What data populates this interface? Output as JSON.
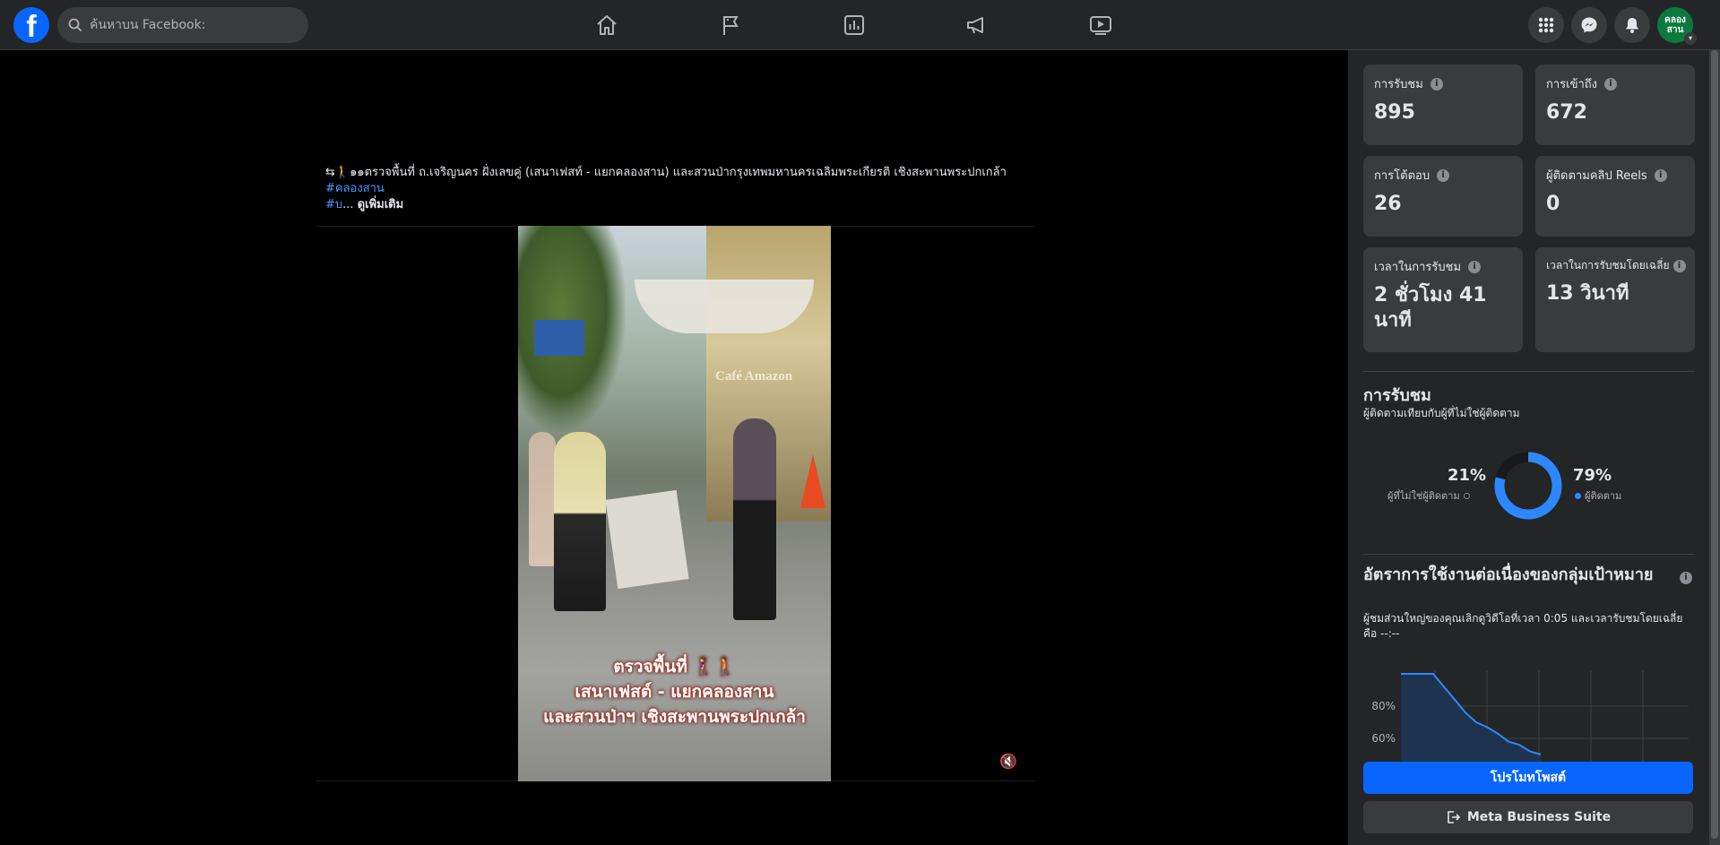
{
  "topbar": {
    "logo": "f",
    "search_placeholder": "ค้นหาบน Facebook:",
    "nav": [
      "home-icon",
      "flag-icon",
      "insights-icon",
      "megaphone-icon",
      "video-icon"
    ],
    "avatar_text": "คลอง สาน"
  },
  "post": {
    "caption": "⇆🚶๑๑ตรวจพื้นที่ ถ.เจริญนคร ฝั่งเลขคู่ (เสนาเฟสท์ - แยกคลองสาน) และสวนป่ากรุงเทพมหานครเฉลิมพระเกียรติ เชิงสะพานพระปกเกล้า",
    "hashtag1": "#คลองสาน",
    "hashtag2": "#บ",
    "ellipsis": "...",
    "see_more": "ดูเพิ่มเติม",
    "video_sign": "Café Amazon",
    "video_caption_1": "ตรวจพื้นที่ 🚶‍♀️🚶",
    "video_caption_2": "เสนาเฟสต์ - แยกคลองสาน",
    "video_caption_3": "และสวนป่าฯ เชิงสะพานพระปกเกล้า",
    "mute_icon": "🔇"
  },
  "stats": {
    "views_label": "การรับชม",
    "views": "895",
    "reach_label": "การเข้าถึง",
    "reach": "672",
    "interactions_label": "การโต้ตอบ",
    "interactions": "26",
    "reels_followers_label": "ผู้ติดตามคลิป Reels",
    "reels_followers": "0",
    "watch_time_label": "เวลาในการรับชม",
    "watch_time": "2 ชั่วโมง 41 นาที",
    "avg_watch_label": "เวลาในการรับชมโดยเฉลี่ย",
    "avg_watch": "13 วินาที"
  },
  "views_section": {
    "title": "การรับชม",
    "subtitle": "ผู้ติดตามเทียบกับผู้ที่ไม่ใช่ผู้ติดตาม",
    "non_followers_pct": "21%",
    "non_followers_label": "ผู้ที่ไม่ใช่ผู้ติดตาม",
    "followers_pct": "79%",
    "followers_label": "ผู้ติดตาม",
    "non_followers_value": 21,
    "followers_value": 79,
    "followers_color": "#2d88ff",
    "non_followers_color": "#18191a"
  },
  "retention": {
    "title": "อัตราการใช้งานต่อเนื่องของกลุ่มเป้าหมาย",
    "subtitle": "ผู้ชมส่วนใหญ่ของคุณเลิกดูวิดีโอที่เวลา 0:05 และเวลารับชมโดยเฉลี่ยคือ --:--",
    "y_ticks": [
      "80%",
      "60%"
    ]
  },
  "chart_data": {
    "type": "area",
    "y_ticks": [
      80,
      60
    ],
    "values": [
      100,
      100,
      100,
      100,
      92,
      84,
      76,
      70,
      67,
      63,
      58,
      56,
      52,
      50
    ]
  },
  "buttons": {
    "promote": "โปรโมทโพสต์",
    "business_suite": "Meta Business Suite"
  },
  "colors": {
    "accent": "#0866ff",
    "panel": "#242526",
    "card": "#3a3b3c"
  }
}
